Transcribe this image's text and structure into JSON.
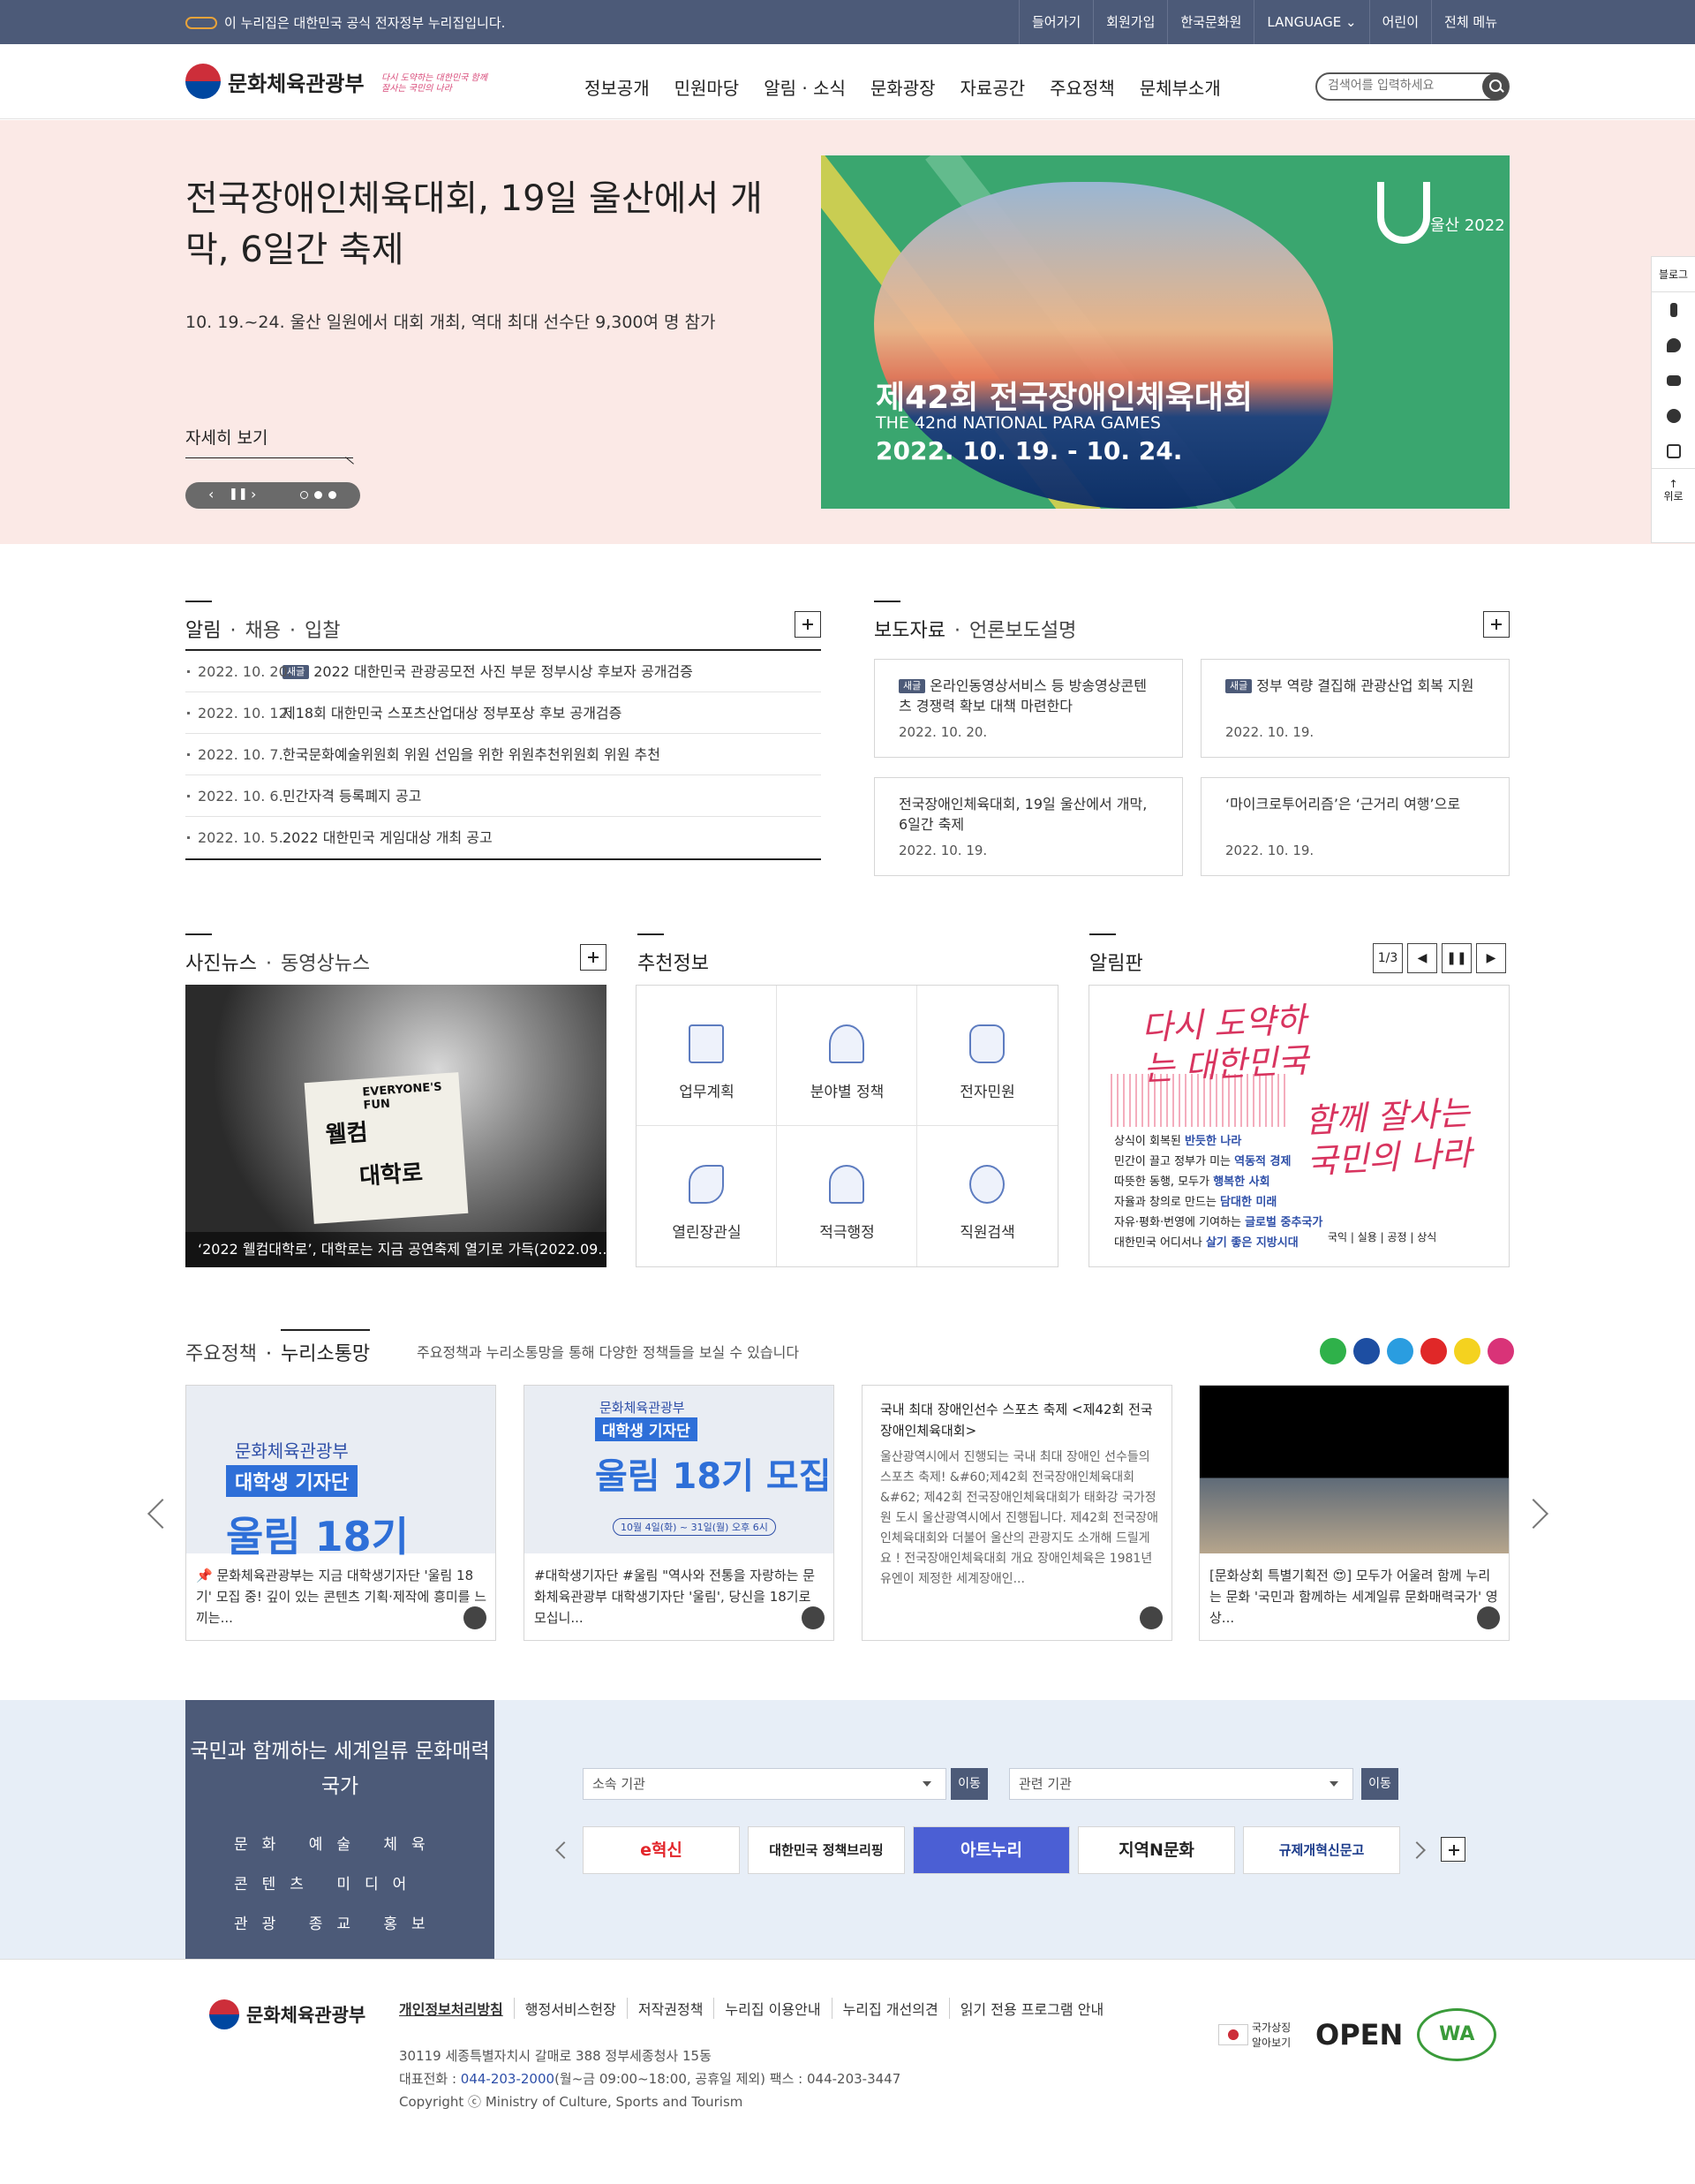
{
  "topbar": {
    "gov_notice": "이 누리집은 대한민국 공식 전자정부 누리집입니다.",
    "links": [
      "들어가기",
      "회원가입",
      "한국문화원",
      "LANGUAGE",
      "어린이",
      "전체 메뉴"
    ]
  },
  "header": {
    "logo": "문화체육관광부",
    "slogan": "다시 도약하는 대한민국 함께 잘사는 국민의 나라",
    "gnb": [
      "정보공개",
      "민원마당",
      "알림 · 소식",
      "문화광장",
      "자료공간",
      "주요정책",
      "문체부소개"
    ],
    "search_placeholder": "검색어를 입력하세요"
  },
  "hero": {
    "title": "전국장애인체육대회, 19일 울산에서 개막, 6일간 축제",
    "desc": "10. 19.~24. 울산 일원에서 대회 개최, 역대 최대 선수단 9,300여 명 참가",
    "more": "자세히 보기",
    "banner": {
      "title_ko": "제42회 전국장애인체육대회",
      "title_en": "THE 42nd NATIONAL PARA GAMES",
      "dates": "2022. 10. 19. - 10. 24.",
      "emblem": "울산 2022"
    }
  },
  "quick": {
    "items": [
      "블로그",
      "facebook-icon",
      "twitter-icon",
      "youtube-icon",
      "kakao-icon",
      "instagram-icon"
    ],
    "top": "위로"
  },
  "notice": {
    "tab1": "알림",
    "tab2": "채용",
    "tab3": "입찰",
    "items": [
      {
        "date": "2022. 10. 20.",
        "new": "새글",
        "title": "2022 대한민국 관광공모전 사진 부문 정부시상 후보자 공개검증"
      },
      {
        "date": "2022. 10. 12.",
        "new": "",
        "title": "제18회 대한민국 스포츠산업대상 정부포상 후보 공개검증"
      },
      {
        "date": "2022. 10. 7.",
        "new": "",
        "title": "한국문화예술위원회 위원 선임을 위한 위원추천위원회 위원 추천"
      },
      {
        "date": "2022. 10. 6.",
        "new": "",
        "title": "민간자격 등록폐지 공고"
      },
      {
        "date": "2022. 10. 5.",
        "new": "",
        "title": "2022 대한민국 게임대상 개최 공고"
      }
    ]
  },
  "press": {
    "tab1": "보도자료",
    "tab2": "언론보도설명",
    "items": [
      {
        "new": "새글",
        "title": "온라인동영상서비스 등 방송영상콘텐츠 경쟁력 확보 대책 마련한다",
        "date": "2022. 10. 20."
      },
      {
        "new": "새글",
        "title": "정부 역량 결집해 관광산업 회복 지원",
        "date": "2022. 10. 19."
      },
      {
        "new": "",
        "title": "전국장애인체육대회, 19일 울산에서 개막, 6일간 축제",
        "date": "2022. 10. 19."
      },
      {
        "new": "",
        "title": "‘마이크로투어리즘’은 ‘근거리 여행’으로",
        "date": "2022. 10. 19."
      }
    ]
  },
  "photo": {
    "tab1": "사진뉴스",
    "tab2": "동영상뉴스",
    "board_text1": "EVERYONE'S FUN",
    "board_text2": "웰컴",
    "board_text3": "대학로",
    "caption": "‘2022 웰컴대학로’, 대학로는 지금 공연축제 열기로 가득(2022.09...."
  },
  "reco": {
    "title": "추천정보",
    "items": [
      "업무계획",
      "분야별 정책",
      "전자민원",
      "열린장관실",
      "적극행정",
      "직원검색"
    ]
  },
  "board": {
    "title": "알림판",
    "page": "1/3",
    "headline1": "다시 도약하는 대한민국",
    "headline2": "함께 잘사는 국민의 나라",
    "lines": [
      {
        "pre": "상식이 회복된 ",
        "b": "반듯한 나라"
      },
      {
        "pre": "민간이 끌고 정부가 미는 ",
        "b": "역동적 경제"
      },
      {
        "pre": "따뜻한 동행, 모두가 ",
        "b": "행복한 사회"
      },
      {
        "pre": "자율과 창의로 만드는 ",
        "b": "담대한 미래"
      },
      {
        "pre": "자유·평화·번영에 기여하는 ",
        "b": "글로벌 중추국가"
      },
      {
        "pre": "대한민국 어디서나 ",
        "b": "살기 좋은 지방시대"
      }
    ],
    "tail": "국익 | 실용 | 공정 | 상식"
  },
  "policy": {
    "tab1": "주요정책",
    "tab2": "누리소통망",
    "subtitle": "주요정책과 누리소통망을 통해 다양한 정책들을 보실 수 있습니다",
    "cards": [
      {
        "img_l1": "문화체육관광부",
        "img_l2": "대학생 기자단",
        "img_l3": "울림 18기",
        "text": "📌 문화체육관광부는 지금 대학생기자단 '울림 18기' 모집 중! 깊이 있는 콘텐츠 기획·제작에 흥미를 느끼는...",
        "sns": "twitter-icon"
      },
      {
        "img_l1": "문화체육관광부",
        "img_l2": "대학생 기자단",
        "img_l3": "울림 18기 모집",
        "img_l4": "10월 4일(화) ~ 31일(월) 오후 6시",
        "text": "#대학생기자단 #울림 \"역사와 전통을 자랑하는 문화체육관광부 대학생기자단 '울림', 당신을 18기로 모십니...",
        "sns": "facebook-icon"
      },
      {
        "title": "국내 최대 장애인선수 스포츠 축제 <제42회 전국장애인체육대회>",
        "body": "울산광역시에서 진행되는 국내 최대 장애인 선수들의 스포츠 축제! &#60;제42회 전국장애인체육대회&#62; 제42회 전국장애인체육대회가 태화강 국가정원 도시 울산광역시에서 진행됩니다. 제42회 전국장애인체육대회와 더불어 울산의 관광지도 소개해 드릴게요 ! 전국장애인체육대회 개요 장애인체육은 1981년 유엔이 제정한 세계장애인...",
        "sns": "blog-icon"
      },
      {
        "text": "[문화상회 특별기획전 😍] 모두가 어울려 함께 누리는 문화 '국민과 함께하는 세계일류 문화매력국가' 영상...",
        "sns": "instagram-icon"
      }
    ]
  },
  "band": {
    "title": "국민과 함께하는 세계일류 문화매력국가",
    "goals": [
      "문화",
      "예술",
      "체육",
      "콘텐츠",
      "미디어",
      "관광",
      "종교",
      "홍보"
    ],
    "select1": "소속 기관",
    "select2": "관련 기관",
    "go": "이동",
    "orgs": [
      "e혁신",
      "대한민국 정책브리핑",
      "아트누리",
      "지역N문화",
      "규제개혁신문고"
    ]
  },
  "footer": {
    "logo": "문화체육관광부",
    "links": [
      "개인정보처리방침",
      "행정서비스헌장",
      "저작권정책",
      "누리집 이용안내",
      "누리집 개선의견",
      "읽기 전용 프로그램 안내"
    ],
    "address": "30119 세종특별자치시 갈매로 388 정부세종청사 15동",
    "tel_label": "대표전화 : ",
    "tel": "044-203-2000",
    "tel_rest": "(월~금 09:00~18:00, 공휴일 제외)  팩스 : 044-203-3447",
    "copyright": "Copyright ⓒ Ministry of Culture, Sports and Tourism",
    "marks": [
      "국가상징 알아보기",
      "OPEN",
      "WA"
    ]
  }
}
